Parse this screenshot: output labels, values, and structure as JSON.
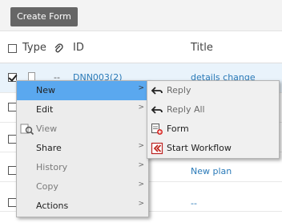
{
  "toolbar": {
    "create_form_label": "Create Form"
  },
  "grid": {
    "headers": {
      "type": "Type",
      "id": "ID",
      "title": "Title"
    },
    "rows": [
      {
        "id": "DNN003(2)",
        "dash": "--",
        "title": "details change",
        "checked": true
      },
      {
        "title": ""
      },
      {
        "title": ""
      },
      {
        "title": "New plan"
      },
      {
        "title": "--"
      }
    ]
  },
  "context_menu": {
    "items": [
      {
        "label": "New",
        "has_submenu": true,
        "active": true
      },
      {
        "label": "Edit",
        "has_submenu": true
      },
      {
        "label": "View",
        "disabled": true,
        "icon": "view-icon"
      },
      {
        "label": "Share",
        "has_submenu": true
      },
      {
        "label": "History",
        "has_submenu": true,
        "disabled": true
      },
      {
        "label": "Copy",
        "has_submenu": true,
        "disabled": true
      },
      {
        "label": "Actions",
        "has_submenu": true
      }
    ],
    "arrow_glyph": ">"
  },
  "submenu": {
    "items": [
      {
        "label": "Reply",
        "icon": "reply-icon",
        "disabled": true
      },
      {
        "label": "Reply All",
        "icon": "reply-all-icon",
        "disabled": true
      },
      {
        "label": "Form",
        "icon": "new-form-icon"
      },
      {
        "label": "Start Workflow",
        "icon": "start-workflow-icon"
      }
    ]
  },
  "colors": {
    "menu_highlight": "#5aa8ef",
    "link": "#2a7ab8",
    "button": "#666666"
  }
}
